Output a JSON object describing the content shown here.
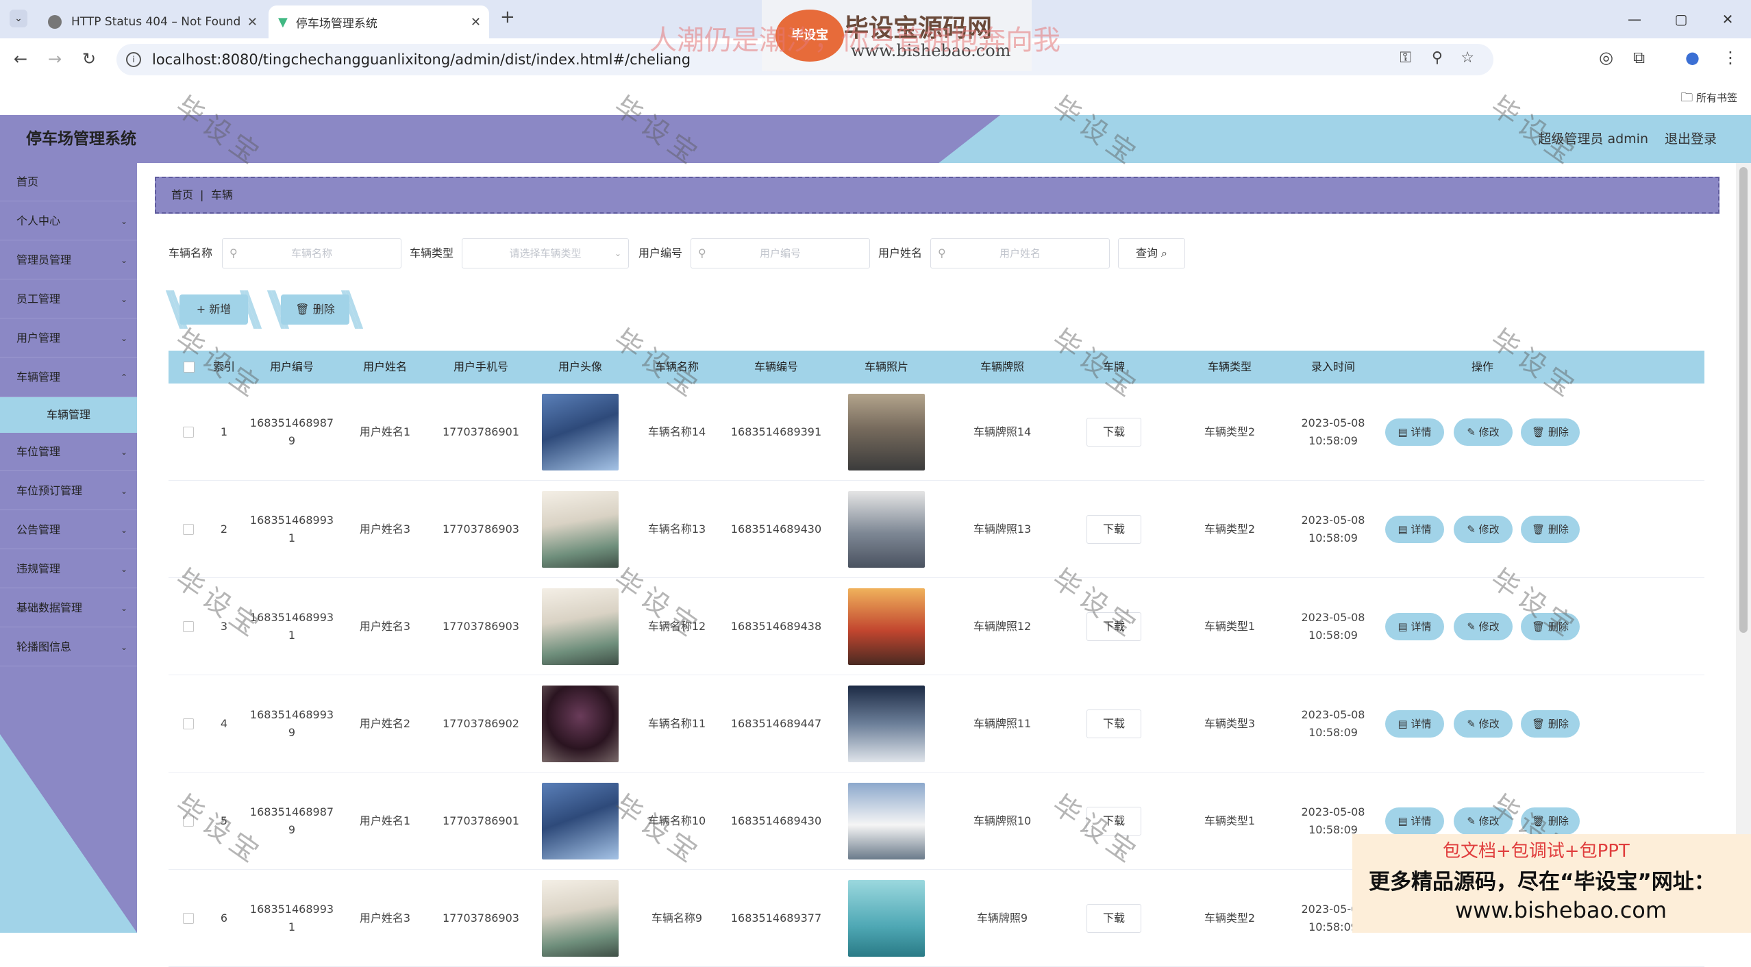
{
  "browser": {
    "tabs": [
      {
        "title": "HTTP Status 404 – Not Found",
        "active": false
      },
      {
        "title": "停车场管理系统",
        "active": true
      }
    ],
    "new_tab": "+",
    "url": "localhost:8080/tingchechangguanlixitong/admin/dist/index.html#/cheliang",
    "bookmarks_folder": "所有书签",
    "window_controls": [
      "—",
      "▢",
      "✕"
    ]
  },
  "header": {
    "title": "停车场管理系统",
    "admin_label": "超级管理员 admin",
    "logout": "退出登录"
  },
  "sidebar": {
    "items": [
      {
        "label": "首页",
        "chev": ""
      },
      {
        "label": "个人中心",
        "chev": "⌄"
      },
      {
        "label": "管理员管理",
        "chev": "⌄"
      },
      {
        "label": "员工管理",
        "chev": "⌄"
      },
      {
        "label": "用户管理",
        "chev": "⌄"
      },
      {
        "label": "车辆管理",
        "chev": "⌃"
      },
      {
        "label": "车位管理",
        "chev": "⌄"
      },
      {
        "label": "车位预订管理",
        "chev": "⌄"
      },
      {
        "label": "公告管理",
        "chev": "⌄"
      },
      {
        "label": "违规管理",
        "chev": "⌄"
      },
      {
        "label": "基础数据管理",
        "chev": "⌄"
      },
      {
        "label": "轮播图信息",
        "chev": "⌄"
      }
    ],
    "active_sub": "车辆管理"
  },
  "breadcrumb": {
    "home": "首页",
    "sep": "|",
    "current": "车辆"
  },
  "search": {
    "vehicle_name_label": "车辆名称",
    "vehicle_name_ph": "车辆名称",
    "vehicle_type_label": "车辆类型",
    "vehicle_type_ph": "请选择车辆类型",
    "user_no_label": "用户编号",
    "user_no_ph": "用户编号",
    "user_name_label": "用户姓名",
    "user_name_ph": "用户姓名",
    "query": "查询 ⌕"
  },
  "actions": {
    "add": "+ 新增",
    "delete": "🗑 删除"
  },
  "table": {
    "columns": [
      "索引",
      "用户编号",
      "用户姓名",
      "用户手机号",
      "用户头像",
      "车辆名称",
      "车辆编号",
      "车辆照片",
      "车辆牌照",
      "车牌",
      "车辆类型",
      "录入时间",
      "操作"
    ],
    "download": "下载",
    "op_detail": "▤ 详情",
    "op_edit": "✎ 修改",
    "op_delete": "🗑 删除",
    "rows": [
      {
        "idx": "1",
        "user_no": "1683514689879",
        "user_name": "用户姓名1",
        "phone": "17703786901",
        "avatar": "avatar-1",
        "car_name": "车辆名称14",
        "car_no": "1683514689391",
        "car_photo": "car-road",
        "plate": "车辆牌照14",
        "type": "车辆类型2",
        "time": "2023-05-08 10:58:09"
      },
      {
        "idx": "2",
        "user_no": "1683514689931",
        "user_name": "用户姓名3",
        "phone": "17703786903",
        "avatar": "avatar-3",
        "car_name": "车辆名称13",
        "car_no": "1683514689430",
        "car_photo": "car-grey",
        "plate": "车辆牌照13",
        "type": "车辆类型2",
        "time": "2023-05-08 10:58:09"
      },
      {
        "idx": "3",
        "user_no": "1683514689931",
        "user_name": "用户姓名3",
        "phone": "17703786903",
        "avatar": "avatar-3",
        "car_name": "车辆名称12",
        "car_no": "1683514689438",
        "car_photo": "car-red",
        "plate": "车辆牌照12",
        "type": "车辆类型1",
        "time": "2023-05-08 10:58:09"
      },
      {
        "idx": "4",
        "user_no": "1683514689939",
        "user_name": "用户姓名2",
        "phone": "17703786902",
        "avatar": "avatar-2",
        "car_name": "车辆名称11",
        "car_no": "1683514689447",
        "car_photo": "car-white",
        "plate": "车辆牌照11",
        "type": "车辆类型3",
        "time": "2023-05-08 10:58:09"
      },
      {
        "idx": "5",
        "user_no": "1683514689879",
        "user_name": "用户姓名1",
        "phone": "17703786901",
        "avatar": "avatar-1",
        "car_name": "车辆名称10",
        "car_no": "1683514689430",
        "car_photo": "car-van",
        "plate": "车辆牌照10",
        "type": "车辆类型1",
        "time": "2023-05-08 10:58:09"
      },
      {
        "idx": "6",
        "user_no": "1683514689931",
        "user_name": "用户姓名3",
        "phone": "17703786903",
        "avatar": "avatar-3",
        "car_name": "车辆名称9",
        "car_no": "1683514689377",
        "car_photo": "car-teal",
        "plate": "车辆牌照9",
        "type": "车辆类型2",
        "time": "2023-05-08 10:58:09"
      }
    ]
  },
  "overlay": {
    "watermark": "毕设宝",
    "logo_text": "毕设宝",
    "site_name": "毕设宝源码网",
    "site_url": "www.bishebao.com",
    "slogan": "人潮仍是潮汐，你只管拥抱奔向我",
    "ad_line1": "包文档+包调试+包PPT",
    "ad_line2": "更多精品源码，尽在“毕设宝”网址：",
    "ad_line3": "www.bishebao.com"
  },
  "colors": {
    "primary": "#8b88c5",
    "accent": "#a1d3e8"
  }
}
